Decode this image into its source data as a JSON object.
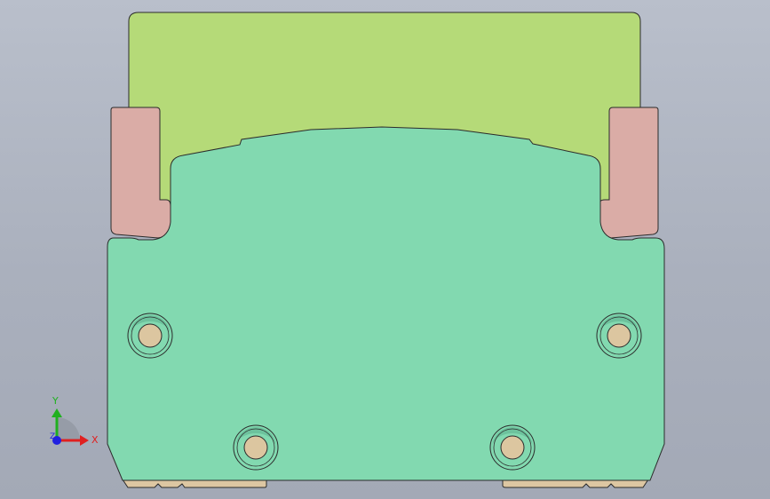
{
  "viewport": {
    "background_top": "#b9bfcb",
    "background_bottom": "#a3a9b6"
  },
  "part": {
    "colors": {
      "upper_block": "#b5da78",
      "side_blocks": "#daaca6",
      "main_body": "#82d9b0",
      "bottom_strips": "#ddc7a2",
      "hole_ring": "#82d9b0",
      "hole_ring_shade": "#5fb391",
      "hole_core": "#dcc6a0",
      "outline": "#2b2b2b"
    },
    "hole_count": 4
  },
  "triad": {
    "icon": "axis-triad-icon",
    "x_label": "X",
    "y_label": "Y",
    "z_label": "Z",
    "colors": {
      "x": "#e02020",
      "y": "#20b020",
      "z": "#2020e0"
    }
  }
}
